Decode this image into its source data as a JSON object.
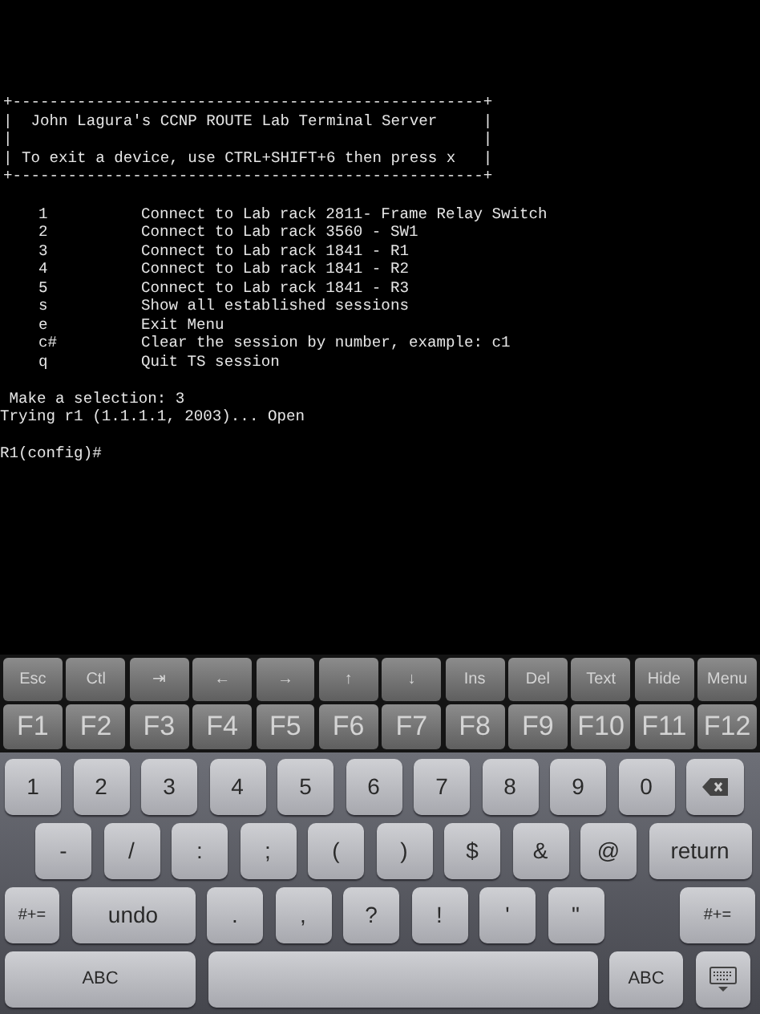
{
  "terminal": {
    "lines_before": [
      "+---------------------------------------------------+",
      "|  John Lagura's CCNP ROUTE Lab Terminal Server     |",
      "|                                                   |",
      "| To exit a device, use CTRL+SHIFT+6 then press x   |",
      "+---------------------------------------------------+"
    ],
    "menu": [
      {
        "key": "1",
        "text": "Connect to Lab rack 2811- Frame Relay Switch"
      },
      {
        "key": "2",
        "text": "Connect to Lab rack 3560 - SW1"
      },
      {
        "key": "3",
        "text": "Connect to Lab rack 1841 - R1"
      },
      {
        "key": "4",
        "text": "Connect to Lab rack 1841 - R2"
      },
      {
        "key": "5",
        "text": "Connect to Lab rack 1841 - R3"
      },
      {
        "key": "s",
        "text": "Show all established sessions"
      },
      {
        "key": "e",
        "text": "Exit Menu"
      },
      {
        "key": "c#",
        "text": "Clear the session by number, example: c1"
      },
      {
        "key": "q",
        "text": "Quit TS session"
      }
    ],
    "lines_after": [
      " Make a selection: 3",
      "Trying r1 (1.1.1.1, 2003)... Open"
    ],
    "prompt": "R1(config)#"
  },
  "tool_rows": [
    [
      "Esc",
      "Ctl",
      "⇥",
      "←",
      "→",
      "↑",
      "↓",
      "Ins",
      "Del",
      "Text",
      "Hide",
      "Menu"
    ],
    [
      "F1",
      "F2",
      "F3",
      "F4",
      "F5",
      "F6",
      "F7",
      "F8",
      "F9",
      "F10",
      "F11",
      "F12"
    ]
  ],
  "keyboard_rows": [
    [
      {
        "kind": "key",
        "label": "1"
      },
      {
        "kind": "key",
        "label": "2"
      },
      {
        "kind": "key",
        "label": "3"
      },
      {
        "kind": "key",
        "label": "4"
      },
      {
        "kind": "key",
        "label": "5"
      },
      {
        "kind": "key",
        "label": "6"
      },
      {
        "kind": "key",
        "label": "7"
      },
      {
        "kind": "key",
        "label": "8"
      },
      {
        "kind": "key",
        "label": "9"
      },
      {
        "kind": "key",
        "label": "0"
      },
      {
        "kind": "backspace"
      }
    ],
    [
      {
        "kind": "key",
        "label": "-"
      },
      {
        "kind": "key",
        "label": "/"
      },
      {
        "kind": "key",
        "label": ":"
      },
      {
        "kind": "key",
        "label": ";"
      },
      {
        "kind": "key",
        "label": "("
      },
      {
        "kind": "key",
        "label": ")"
      },
      {
        "kind": "key",
        "label": "$"
      },
      {
        "kind": "key",
        "label": "&"
      },
      {
        "kind": "key",
        "label": "@"
      },
      {
        "kind": "return",
        "label": "return"
      }
    ],
    [
      {
        "kind": "small",
        "label": "#+="
      },
      {
        "kind": "undo",
        "label": "undo"
      },
      {
        "kind": "key",
        "label": "."
      },
      {
        "kind": "key",
        "label": ","
      },
      {
        "kind": "key",
        "label": "?"
      },
      {
        "kind": "key",
        "label": "!"
      },
      {
        "kind": "key",
        "label": "'"
      },
      {
        "kind": "key",
        "label": "\""
      },
      {
        "kind": "right",
        "label": "#+="
      }
    ],
    [
      {
        "kind": "abc_wide",
        "label": "ABC"
      },
      {
        "kind": "space"
      },
      {
        "kind": "abc",
        "label": "ABC"
      },
      {
        "kind": "hide"
      }
    ]
  ]
}
